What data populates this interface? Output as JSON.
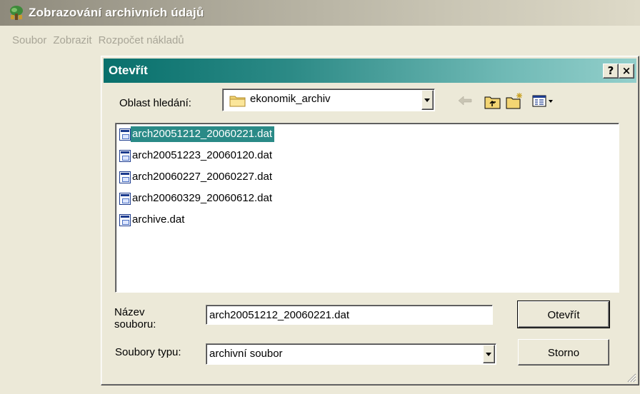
{
  "window": {
    "title": "Zobrazování archivních údajů"
  },
  "menu": {
    "items": [
      "Soubor",
      "Zobrazit",
      "Rozpočet nákladů"
    ]
  },
  "dialog": {
    "title": "Otevřít",
    "help_label": "?",
    "close_label": "×",
    "look_in_label": "Oblast hledání:",
    "look_in_value": "ekonomik_archiv",
    "files": [
      "arch20051212_20060221.dat",
      "arch20051223_20060120.dat",
      "arch20060227_20060227.dat",
      "arch20060329_20060612.dat",
      "archive.dat"
    ],
    "selected_file_index": 0,
    "filename_label": "Název souboru:",
    "filename_value": "arch20051212_20060221.dat",
    "filetype_label": "Soubory typu:",
    "filetype_value": "archivní soubor",
    "open_button": "Otevřít",
    "cancel_button": "Storno",
    "icons": [
      "back-arrow-icon",
      "up-folder-icon",
      "new-folder-icon",
      "view-menu-icon"
    ]
  },
  "colors": {
    "dialog_title_bg": "#2c8a86",
    "selection_bg": "#2a8a87",
    "window_bg": "#ece9d8"
  }
}
